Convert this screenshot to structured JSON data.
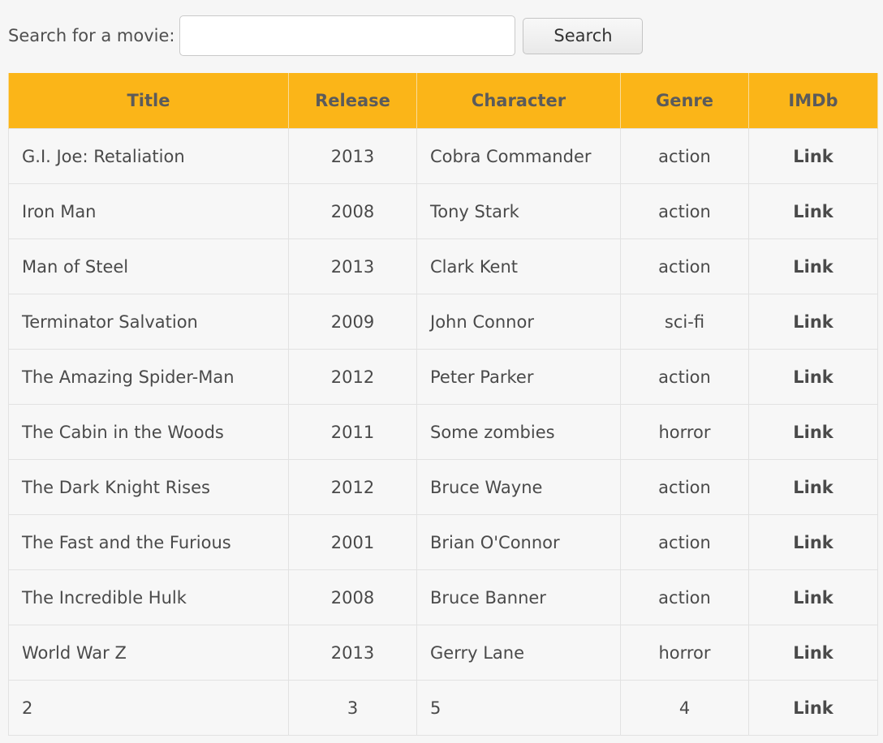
{
  "search": {
    "label": "Search for a movie:",
    "value": "",
    "placeholder": "",
    "button_label": "Search"
  },
  "table": {
    "columns": [
      "Title",
      "Release",
      "Character",
      "Genre",
      "IMDb"
    ],
    "rows": [
      {
        "title": "G.I. Joe: Retaliation",
        "release": "2013",
        "character": "Cobra Commander",
        "genre": "action",
        "imdb": "Link"
      },
      {
        "title": "Iron Man",
        "release": "2008",
        "character": "Tony Stark",
        "genre": "action",
        "imdb": "Link"
      },
      {
        "title": "Man of Steel",
        "release": "2013",
        "character": "Clark Kent",
        "genre": "action",
        "imdb": "Link"
      },
      {
        "title": "Terminator Salvation",
        "release": "2009",
        "character": "John Connor",
        "genre": "sci-fi",
        "imdb": "Link"
      },
      {
        "title": "The Amazing Spider-Man",
        "release": "2012",
        "character": "Peter Parker",
        "genre": "action",
        "imdb": "Link"
      },
      {
        "title": "The Cabin in the Woods",
        "release": "2011",
        "character": "Some zombies",
        "genre": "horror",
        "imdb": "Link"
      },
      {
        "title": "The Dark Knight Rises",
        "release": "2012",
        "character": "Bruce Wayne",
        "genre": "action",
        "imdb": "Link"
      },
      {
        "title": "The Fast and the Furious",
        "release": "2001",
        "character": "Brian O'Connor",
        "genre": "action",
        "imdb": "Link"
      },
      {
        "title": "The Incredible Hulk",
        "release": "2008",
        "character": "Bruce Banner",
        "genre": "action",
        "imdb": "Link"
      },
      {
        "title": "World War Z",
        "release": "2013",
        "character": "Gerry Lane",
        "genre": "horror",
        "imdb": "Link"
      }
    ],
    "footer": {
      "title": "2",
      "release": "3",
      "character": "5",
      "genre": "4",
      "imdb": "Link"
    }
  },
  "colors": {
    "header_bg": "#fbb518",
    "header_text": "#5b5b5b",
    "page_bg": "#f6f6f6"
  }
}
